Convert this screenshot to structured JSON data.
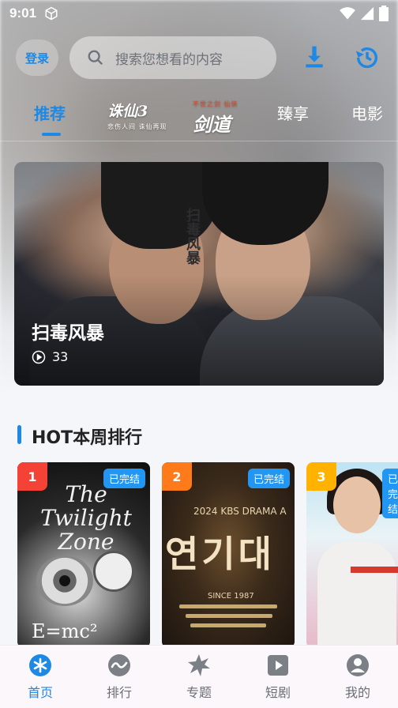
{
  "status_bar": {
    "time": "9:01"
  },
  "header": {
    "login_label": "登录",
    "search_placeholder": "搜索您想看的内容"
  },
  "tabs": [
    {
      "label": "推荐",
      "active": true
    },
    {
      "label": "诛仙3",
      "sub": "悲伤人间 诛仙再现",
      "logo": true
    },
    {
      "label": "剑道",
      "sub": "不世之剑 仙侠",
      "logo": true
    },
    {
      "label": "臻享"
    },
    {
      "label": "电影"
    }
  ],
  "banner": {
    "title": "扫毒风暴",
    "poster_text": "扫毒风暴",
    "plays": "33"
  },
  "section": {
    "title": "HOT本周排行"
  },
  "ranking": [
    {
      "rank": "1",
      "status": "已完结",
      "rank_color": "#f44336",
      "poster_title": "The Twilight Zone",
      "poster_formula": "E=mc²"
    },
    {
      "rank": "2",
      "status": "已完结",
      "rank_color": "#ff7a1a",
      "poster_line1": "2024 KBS DRAMA A",
      "poster_line2": "연기대",
      "poster_line3": "SINCE 1987"
    },
    {
      "rank": "3",
      "status": "已完结",
      "rank_color": "#ffb300"
    }
  ],
  "bottom_nav": [
    {
      "label": "首页",
      "icon": "home-asterisk-icon",
      "active": true
    },
    {
      "label": "排行",
      "icon": "ranking-wave-icon",
      "active": false
    },
    {
      "label": "专题",
      "icon": "topic-star-icon",
      "active": false
    },
    {
      "label": "短剧",
      "icon": "short-play-icon",
      "active": false
    },
    {
      "label": "我的",
      "icon": "profile-icon",
      "active": false
    }
  ],
  "colors": {
    "accent": "#1e88e5",
    "badge": "#2196f3"
  }
}
